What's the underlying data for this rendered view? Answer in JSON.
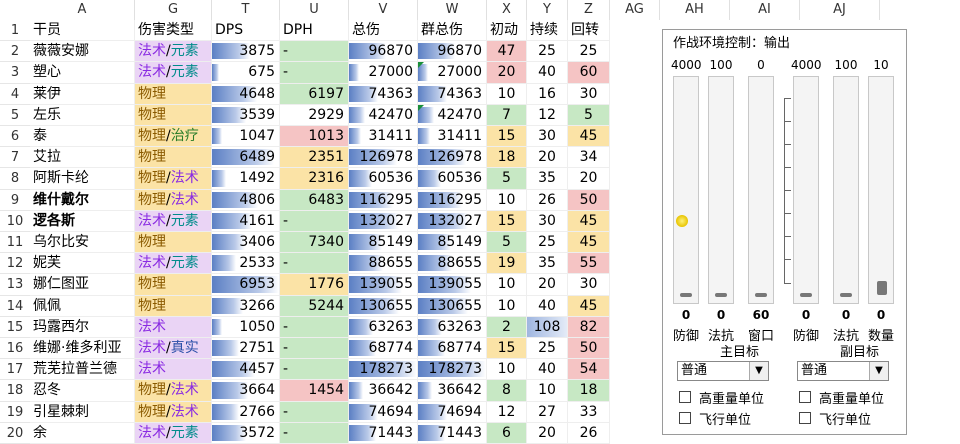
{
  "columns": [
    {
      "letter": "A"
    },
    {
      "letter": "G"
    },
    {
      "letter": "T"
    },
    {
      "letter": "U"
    },
    {
      "letter": "V"
    },
    {
      "letter": "W"
    },
    {
      "letter": "X"
    },
    {
      "letter": "Y"
    },
    {
      "letter": "Z"
    },
    {
      "letter": "AG"
    },
    {
      "letter": "AH"
    },
    {
      "letter": "AI"
    },
    {
      "letter": "AJ"
    }
  ],
  "header_row": {
    "num": "1",
    "name": "干员",
    "type": "伤害类型",
    "dps": "DPS",
    "dph": "DPH",
    "total": "总伤",
    "aoe": "群总伤",
    "init": "初动",
    "dur": "持续",
    "cd": "回转"
  },
  "rows": [
    {
      "num": "2",
      "name": "薇薇安娜",
      "type": [
        [
          "法术",
          "magic"
        ],
        [
          "元素",
          "elem"
        ]
      ],
      "type_bg": "#ead4f5",
      "dps": "3875",
      "dps_r": 0.56,
      "dph": "-",
      "dph_bg": "#c7e8c4",
      "total": "96870",
      "total_r": 0.54,
      "aoe": "96870",
      "aoe_r": 0.54,
      "aoe_tri": false,
      "init": "47",
      "init_bg": "#f5c4c4",
      "dur": "25",
      "dur_bg": "",
      "cd": "25",
      "cd_bg": ""
    },
    {
      "num": "3",
      "name": "塑心",
      "type": [
        [
          "法术",
          "magic"
        ],
        [
          "元素",
          "elem"
        ]
      ],
      "type_bg": "#ead4f5",
      "dps": "675",
      "dps_r": 0.1,
      "dph": "-",
      "dph_bg": "#c7e8c4",
      "total": "27000",
      "total_r": 0.15,
      "aoe": "27000",
      "aoe_r": 0.15,
      "aoe_tri": true,
      "init": "20",
      "init_bg": "#f5c4c4",
      "dur": "40",
      "dur_bg": "",
      "cd": "60",
      "cd_bg": "#f5c4c4"
    },
    {
      "num": "4",
      "name": "莱伊",
      "type": [
        [
          "物理",
          "phys"
        ]
      ],
      "type_bg": "#fbe3a6",
      "dps": "4648",
      "dps_r": 0.67,
      "dph": "6197",
      "dph_bg": "#c7e8c4",
      "total": "74363",
      "total_r": 0.42,
      "aoe": "74363",
      "aoe_r": 0.42,
      "aoe_tri": false,
      "init": "10",
      "init_bg": "",
      "dur": "16",
      "dur_bg": "",
      "cd": "30",
      "cd_bg": ""
    },
    {
      "num": "5",
      "name": "左乐",
      "type": [
        [
          "物理",
          "phys"
        ]
      ],
      "type_bg": "#fbe3a6",
      "dps": "3539",
      "dps_r": 0.51,
      "dph": "2929",
      "dph_bg": "",
      "total": "42470",
      "total_r": 0.24,
      "aoe": "42470",
      "aoe_r": 0.24,
      "aoe_tri": true,
      "init": "7",
      "init_bg": "#c7e8c4",
      "dur": "12",
      "dur_bg": "",
      "cd": "5",
      "cd_bg": "#c7e8c4"
    },
    {
      "num": "6",
      "name": "泰",
      "type": [
        [
          "物理",
          "phys"
        ],
        [
          "治疗",
          "heal"
        ]
      ],
      "type_bg": "#fbe3a6",
      "dps": "1047",
      "dps_r": 0.15,
      "dph": "1013",
      "dph_bg": "#f5c4c4",
      "total": "31411",
      "total_r": 0.18,
      "aoe": "31411",
      "aoe_r": 0.18,
      "aoe_tri": false,
      "init": "15",
      "init_bg": "#fbe3a6",
      "dur": "30",
      "dur_bg": "",
      "cd": "45",
      "cd_bg": "#fbe3a6"
    },
    {
      "num": "7",
      "name": "艾拉",
      "type": [
        [
          "物理",
          "phys"
        ]
      ],
      "type_bg": "#fbe3a6",
      "dps": "6489",
      "dps_r": 0.93,
      "dph": "2351",
      "dph_bg": "#fbe3a6",
      "total": "126978",
      "total_r": 0.71,
      "aoe": "126978",
      "aoe_r": 0.71,
      "aoe_tri": false,
      "init": "18",
      "init_bg": "#fbe3a6",
      "dur": "20",
      "dur_bg": "",
      "cd": "34",
      "cd_bg": ""
    },
    {
      "num": "8",
      "name": "阿斯卡纶",
      "type": [
        [
          "物理",
          "phys"
        ],
        [
          "法术",
          "magic"
        ]
      ],
      "type_bg": "#fbe3a6",
      "dps": "1492",
      "dps_r": 0.21,
      "dph": "2316",
      "dph_bg": "#fbe3a6",
      "total": "60536",
      "total_r": 0.34,
      "aoe": "60536",
      "aoe_r": 0.34,
      "aoe_tri": false,
      "init": "5",
      "init_bg": "#c7e8c4",
      "dur": "35",
      "dur_bg": "",
      "cd": "20",
      "cd_bg": ""
    },
    {
      "num": "9",
      "name": "维什戴尔",
      "bold": true,
      "type": [
        [
          "物理",
          "phys"
        ],
        [
          "法术",
          "magic"
        ]
      ],
      "type_bg": "#fbe3a6",
      "dps": "4806",
      "dps_r": 0.69,
      "dph": "6483",
      "dph_bg": "#c7e8c4",
      "total": "116295",
      "total_r": 0.65,
      "aoe": "116295",
      "aoe_r": 0.65,
      "aoe_tri": false,
      "init": "10",
      "init_bg": "",
      "dur": "26",
      "dur_bg": "",
      "cd": "50",
      "cd_bg": "#f5c4c4"
    },
    {
      "num": "10",
      "name": "逻各斯",
      "bold": true,
      "type": [
        [
          "法术",
          "magic"
        ],
        [
          "元素",
          "elem"
        ]
      ],
      "type_bg": "#ead4f5",
      "dps": "4161",
      "dps_r": 0.6,
      "dph": "-",
      "dph_bg": "#c7e8c4",
      "total": "132027",
      "total_r": 0.74,
      "aoe": "132027",
      "aoe_r": 0.74,
      "aoe_tri": false,
      "init": "15",
      "init_bg": "#fbe3a6",
      "dur": "30",
      "dur_bg": "",
      "cd": "45",
      "cd_bg": "#fbe3a6"
    },
    {
      "num": "11",
      "name": "乌尔比安",
      "type": [
        [
          "物理",
          "phys"
        ]
      ],
      "type_bg": "#fbe3a6",
      "dps": "3406",
      "dps_r": 0.49,
      "dph": "7340",
      "dph_bg": "#c7e8c4",
      "total": "85149",
      "total_r": 0.48,
      "aoe": "85149",
      "aoe_r": 0.48,
      "aoe_tri": false,
      "init": "5",
      "init_bg": "#c7e8c4",
      "dur": "25",
      "dur_bg": "",
      "cd": "45",
      "cd_bg": "#fbe3a6"
    },
    {
      "num": "12",
      "name": "妮芙",
      "type": [
        [
          "法术",
          "magic"
        ],
        [
          "元素",
          "elem"
        ]
      ],
      "type_bg": "#ead4f5",
      "dps": "2533",
      "dps_r": 0.36,
      "dph": "-",
      "dph_bg": "#c7e8c4",
      "total": "88655",
      "total_r": 0.5,
      "aoe": "88655",
      "aoe_r": 0.5,
      "aoe_tri": false,
      "init": "19",
      "init_bg": "#fbe3a6",
      "dur": "35",
      "dur_bg": "",
      "cd": "55",
      "cd_bg": "#f5c4c4"
    },
    {
      "num": "13",
      "name": "娜仁图亚",
      "type": [
        [
          "物理",
          "phys"
        ]
      ],
      "type_bg": "#fbe3a6",
      "dps": "6953",
      "dps_r": 1.0,
      "dph": "1776",
      "dph_bg": "#fbe3a6",
      "total": "139055",
      "total_r": 0.78,
      "aoe": "139055",
      "aoe_r": 0.78,
      "aoe_tri": false,
      "init": "10",
      "init_bg": "",
      "dur": "20",
      "dur_bg": "",
      "cd": "30",
      "cd_bg": ""
    },
    {
      "num": "14",
      "name": "佩佩",
      "type": [
        [
          "物理",
          "phys"
        ]
      ],
      "type_bg": "#fbe3a6",
      "dps": "3266",
      "dps_r": 0.47,
      "dph": "5244",
      "dph_bg": "#c7e8c4",
      "total": "130655",
      "total_r": 0.73,
      "aoe": "130655",
      "aoe_r": 0.73,
      "aoe_tri": false,
      "init": "10",
      "init_bg": "",
      "dur": "40",
      "dur_bg": "",
      "cd": "45",
      "cd_bg": "#fbe3a6"
    },
    {
      "num": "15",
      "name": "玛露西尔",
      "type": [
        [
          "法术",
          "magic"
        ]
      ],
      "type_bg": "#ead4f5",
      "dps": "1050",
      "dps_r": 0.15,
      "dph": "-",
      "dph_bg": "#c7e8c4",
      "total": "63263",
      "total_r": 0.35,
      "aoe": "63263",
      "aoe_r": 0.35,
      "aoe_tri": false,
      "init": "2",
      "init_bg": "#c7e8c4",
      "dur": "108",
      "dur_bg": "#b9c9e8",
      "cd": "82",
      "cd_bg": "#f5c4c4"
    },
    {
      "num": "16",
      "name": "维娜·维多利亚",
      "type": [
        [
          "法术",
          "magic"
        ],
        [
          "真实",
          "true"
        ]
      ],
      "type_bg": "#ead4f5",
      "dps": "2751",
      "dps_r": 0.4,
      "dph": "-",
      "dph_bg": "#c7e8c4",
      "total": "68774",
      "total_r": 0.39,
      "aoe": "68774",
      "aoe_r": 0.39,
      "aoe_tri": false,
      "init": "15",
      "init_bg": "#fbe3a6",
      "dur": "25",
      "dur_bg": "",
      "cd": "50",
      "cd_bg": "#f5c4c4"
    },
    {
      "num": "17",
      "name": "荒芜拉普兰德",
      "type": [
        [
          "法术",
          "magic"
        ]
      ],
      "type_bg": "#ead4f5",
      "dps": "4457",
      "dps_r": 0.64,
      "dph": "-",
      "dph_bg": "#c7e8c4",
      "total": "178273",
      "total_r": 1.0,
      "aoe": "178273",
      "aoe_r": 1.0,
      "aoe_tri": false,
      "init": "10",
      "init_bg": "",
      "dur": "40",
      "dur_bg": "",
      "cd": "54",
      "cd_bg": "#f5c4c4"
    },
    {
      "num": "18",
      "name": "忍冬",
      "type": [
        [
          "物理",
          "phys"
        ],
        [
          "法术",
          "magic"
        ]
      ],
      "type_bg": "#fbe3a6",
      "dps": "3664",
      "dps_r": 0.53,
      "dph": "1454",
      "dph_bg": "#f5c4c4",
      "total": "36642",
      "total_r": 0.21,
      "aoe": "36642",
      "aoe_r": 0.21,
      "aoe_tri": false,
      "init": "8",
      "init_bg": "#c7e8c4",
      "dur": "10",
      "dur_bg": "",
      "cd": "18",
      "cd_bg": "#c7e8c4"
    },
    {
      "num": "19",
      "name": "引星棘刺",
      "type": [
        [
          "物理",
          "phys"
        ],
        [
          "法术",
          "magic"
        ]
      ],
      "type_bg": "#fbe3a6",
      "dps": "2766",
      "dps_r": 0.4,
      "dph": "-",
      "dph_bg": "#c7e8c4",
      "total": "74694",
      "total_r": 0.42,
      "aoe": "74694",
      "aoe_r": 0.42,
      "aoe_tri": false,
      "init": "12",
      "init_bg": "",
      "dur": "27",
      "dur_bg": "",
      "cd": "33",
      "cd_bg": ""
    },
    {
      "num": "20",
      "name": "余",
      "type": [
        [
          "法术",
          "magic"
        ],
        [
          "元素",
          "elem"
        ]
      ],
      "type_bg": "#ead4f5",
      "dps": "3572",
      "dps_r": 0.51,
      "dph": "-",
      "dph_bg": "#c7e8c4",
      "total": "71443",
      "total_r": 0.4,
      "aoe": "71443",
      "aoe_r": 0.4,
      "aoe_tri": false,
      "init": "6",
      "init_bg": "#c7e8c4",
      "dur": "20",
      "dur_bg": "",
      "cd": "26",
      "cd_bg": ""
    }
  ],
  "panel": {
    "title": "作战环境控制：输出",
    "main_group": "主目标",
    "sub_group": "副目标",
    "sliders": [
      {
        "max": "4000",
        "value": "0",
        "label": "防御",
        "level": 0,
        "has_dot": true
      },
      {
        "max": "100",
        "value": "0",
        "label": "法抗",
        "level": 0,
        "has_dot": false
      },
      {
        "max": "0",
        "value": "60",
        "label": "窗口",
        "level": 0,
        "has_dot": false
      },
      {
        "max": "4000",
        "value": "0",
        "label": "防御",
        "level": 0,
        "has_dot": false
      },
      {
        "max": "100",
        "value": "0",
        "label": "法抗",
        "level": 0,
        "has_dot": false
      },
      {
        "max": "10",
        "value": "0",
        "label": "数量",
        "level": 0.05,
        "has_dot": false
      }
    ],
    "select_main": "普通",
    "select_sub": "普通",
    "cb_heavy": "高重量单位",
    "cb_fly": "飞行单位"
  }
}
